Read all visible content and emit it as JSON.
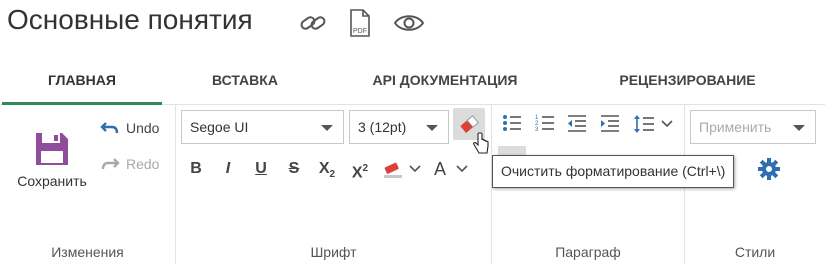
{
  "page": {
    "title": "Основные понятия"
  },
  "title_icons": [
    "link-icon",
    "pdf-icon",
    "eye-icon"
  ],
  "tabs": [
    {
      "label": "ГЛАВНАЯ",
      "active": true
    },
    {
      "label": "ВСТАВКА",
      "active": false
    },
    {
      "label": "API ДОКУМЕНТАЦИЯ",
      "active": false
    },
    {
      "label": "РЕЦЕНЗИРОВАНИЕ",
      "active": false
    }
  ],
  "changes": {
    "save_label": "Сохранить",
    "undo_label": "Undo",
    "redo_label": "Redo",
    "group_label": "Изменения"
  },
  "font": {
    "family_value": "Segoe UI",
    "size_value": "3 (12pt)",
    "bold": "B",
    "italic": "I",
    "underline": "U",
    "strike": "S",
    "subscript": "X",
    "subscript_mark": "2",
    "superscript": "X",
    "superscript_mark": "2",
    "font_color": "A",
    "group_label": "Шрифт"
  },
  "paragraph": {
    "group_label": "Параграф"
  },
  "styles": {
    "apply_placeholder": "Применить",
    "group_label": "Стили"
  },
  "tooltip": {
    "text": "Очистить форматирование (Ctrl+\\)"
  },
  "colors": {
    "accent": "#2e8b57",
    "save_icon": "#8e4e9b",
    "gear": "#2f6fb0",
    "eraser": "#d9413a"
  }
}
